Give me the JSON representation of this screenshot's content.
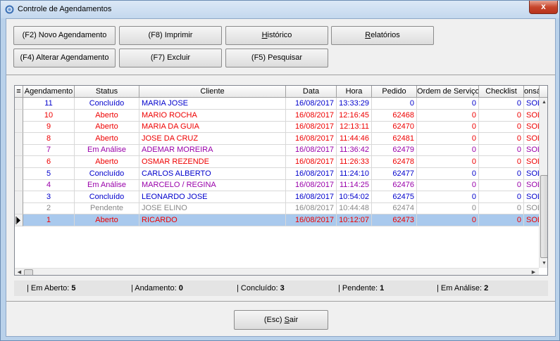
{
  "window": {
    "title": "Controle de Agendamentos",
    "close_label": "x"
  },
  "toolbar": {
    "novo": "(F2) Novo Agendamento",
    "imprimir": "(F8) Imprimir",
    "historico_prefix": "",
    "historico_underlined": "H",
    "historico_rest": "istórico",
    "relatorios_underlined": "R",
    "relatorios_rest": "elatórios",
    "alterar": "(F4) Alterar Agendamento",
    "excluir": "(F7) Excluir",
    "pesquisar": "(F5) Pesquisar"
  },
  "grid": {
    "columns": [
      "Agendamento",
      "Status",
      "Cliente",
      "Data",
      "Hora",
      "Pedido",
      "Ordem de Serviço",
      "Checklist",
      "onsá"
    ],
    "rows": [
      {
        "agendamento": "11",
        "status": "Concluído",
        "cliente": "MARIA JOSE",
        "data": "16/08/2017",
        "hora": "13:33:29",
        "pedido": "0",
        "os": "0",
        "checklist": "0",
        "resp": "SOL",
        "color": "#0000cc"
      },
      {
        "agendamento": "10",
        "status": "Aberto",
        "cliente": "MARIO ROCHA",
        "data": "16/08/2017",
        "hora": "12:16:45",
        "pedido": "62468",
        "os": "0",
        "checklist": "0",
        "resp": "SOL",
        "color": "#ee0000"
      },
      {
        "agendamento": "9",
        "status": "Aberto",
        "cliente": "MARIA DA GUIA",
        "data": "16/08/2017",
        "hora": "12:13:11",
        "pedido": "62470",
        "os": "0",
        "checklist": "0",
        "resp": "SOL",
        "color": "#ee0000"
      },
      {
        "agendamento": "8",
        "status": "Aberto",
        "cliente": "JOSE DA CRUZ",
        "data": "16/08/2017",
        "hora": "11:44:46",
        "pedido": "62481",
        "os": "0",
        "checklist": "0",
        "resp": "SOL",
        "color": "#ee0000"
      },
      {
        "agendamento": "7",
        "status": "Em Análise",
        "cliente": "ADEMAR MOREIRA",
        "data": "16/08/2017",
        "hora": "11:36:42",
        "pedido": "62479",
        "os": "0",
        "checklist": "0",
        "resp": "SOL",
        "color": "#9900aa"
      },
      {
        "agendamento": "6",
        "status": "Aberto",
        "cliente": "OSMAR REZENDE",
        "data": "16/08/2017",
        "hora": "11:26:33",
        "pedido": "62478",
        "os": "0",
        "checklist": "0",
        "resp": "SOL",
        "color": "#ee0000"
      },
      {
        "agendamento": "5",
        "status": "Concluído",
        "cliente": "CARLOS ALBERTO",
        "data": "16/08/2017",
        "hora": "11:24:10",
        "pedido": "62477",
        "os": "0",
        "checklist": "0",
        "resp": "SOL",
        "color": "#0000cc"
      },
      {
        "agendamento": "4",
        "status": "Em Análise",
        "cliente": "MARCELO / REGINA",
        "data": "16/08/2017",
        "hora": "11:14:25",
        "pedido": "62476",
        "os": "0",
        "checklist": "0",
        "resp": "SOL",
        "color": "#9900aa"
      },
      {
        "agendamento": "3",
        "status": "Concluído",
        "cliente": "LEONARDO JOSE",
        "data": "16/08/2017",
        "hora": "10:54:02",
        "pedido": "62475",
        "os": "0",
        "checklist": "0",
        "resp": "SOL",
        "color": "#0000cc"
      },
      {
        "agendamento": "2",
        "status": "Pendente",
        "cliente": "JOSE ELINO",
        "data": "16/08/2017",
        "hora": "10:44:48",
        "pedido": "62474",
        "os": "0",
        "checklist": "0",
        "resp": "SOL",
        "color": "#888888"
      },
      {
        "agendamento": "1",
        "status": "Aberto",
        "cliente": "RICARDO",
        "data": "16/08/2017",
        "hora": "10:12:07",
        "pedido": "62473",
        "os": "0",
        "checklist": "0",
        "resp": "SOL",
        "color": "#ee0000",
        "selected": true
      }
    ]
  },
  "status": {
    "aberto_label": "| Em Aberto:",
    "aberto_value": "5",
    "andamento_label": "| Andamento:",
    "andamento_value": "0",
    "concluido_label": "| Concluído:",
    "concluido_value": "3",
    "pendente_label": "| Pendente:",
    "pendente_value": "1",
    "analise_label": "| Em Análise:",
    "analise_value": "2"
  },
  "footer": {
    "sair_prefix": "(Esc) ",
    "sair_underlined": "S",
    "sair_rest": "air"
  }
}
